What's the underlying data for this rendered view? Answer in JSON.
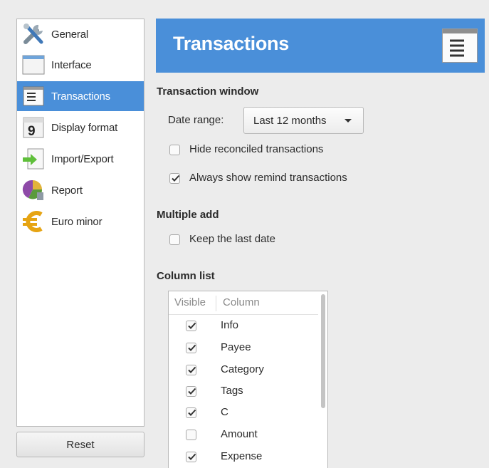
{
  "sidebar": {
    "items": [
      {
        "label": "General",
        "icon": "general-tools-icon"
      },
      {
        "label": "Interface",
        "icon": "interface-window-icon"
      },
      {
        "label": "Transactions",
        "icon": "transactions-list-icon"
      },
      {
        "label": "Display format",
        "icon": "calendar-icon"
      },
      {
        "label": "Import/Export",
        "icon": "import-export-icon"
      },
      {
        "label": "Report",
        "icon": "report-chart-icon"
      },
      {
        "label": "Euro minor",
        "icon": "euro-icon"
      }
    ],
    "active_index": 2,
    "reset_label": "Reset"
  },
  "header": {
    "title": "Transactions",
    "color": "#4a8fd9"
  },
  "transaction_window": {
    "title": "Transaction window",
    "date_range_label": "Date range:",
    "date_range_value": "Last 12 months",
    "hide_reconciled": {
      "label": "Hide reconciled transactions",
      "checked": false
    },
    "always_show_remind": {
      "label": "Always show remind transactions",
      "checked": true
    }
  },
  "multiple_add": {
    "title": "Multiple add",
    "keep_last_date": {
      "label": "Keep the last date",
      "checked": false
    }
  },
  "column_list": {
    "title": "Column list",
    "headers": {
      "visible": "Visible",
      "column": "Column"
    },
    "rows": [
      {
        "name": "Info",
        "visible": true
      },
      {
        "name": "Payee",
        "visible": true
      },
      {
        "name": "Category",
        "visible": true
      },
      {
        "name": "Tags",
        "visible": true
      },
      {
        "name": "C",
        "visible": true
      },
      {
        "name": "Amount",
        "visible": false
      },
      {
        "name": "Expense",
        "visible": true
      }
    ]
  }
}
